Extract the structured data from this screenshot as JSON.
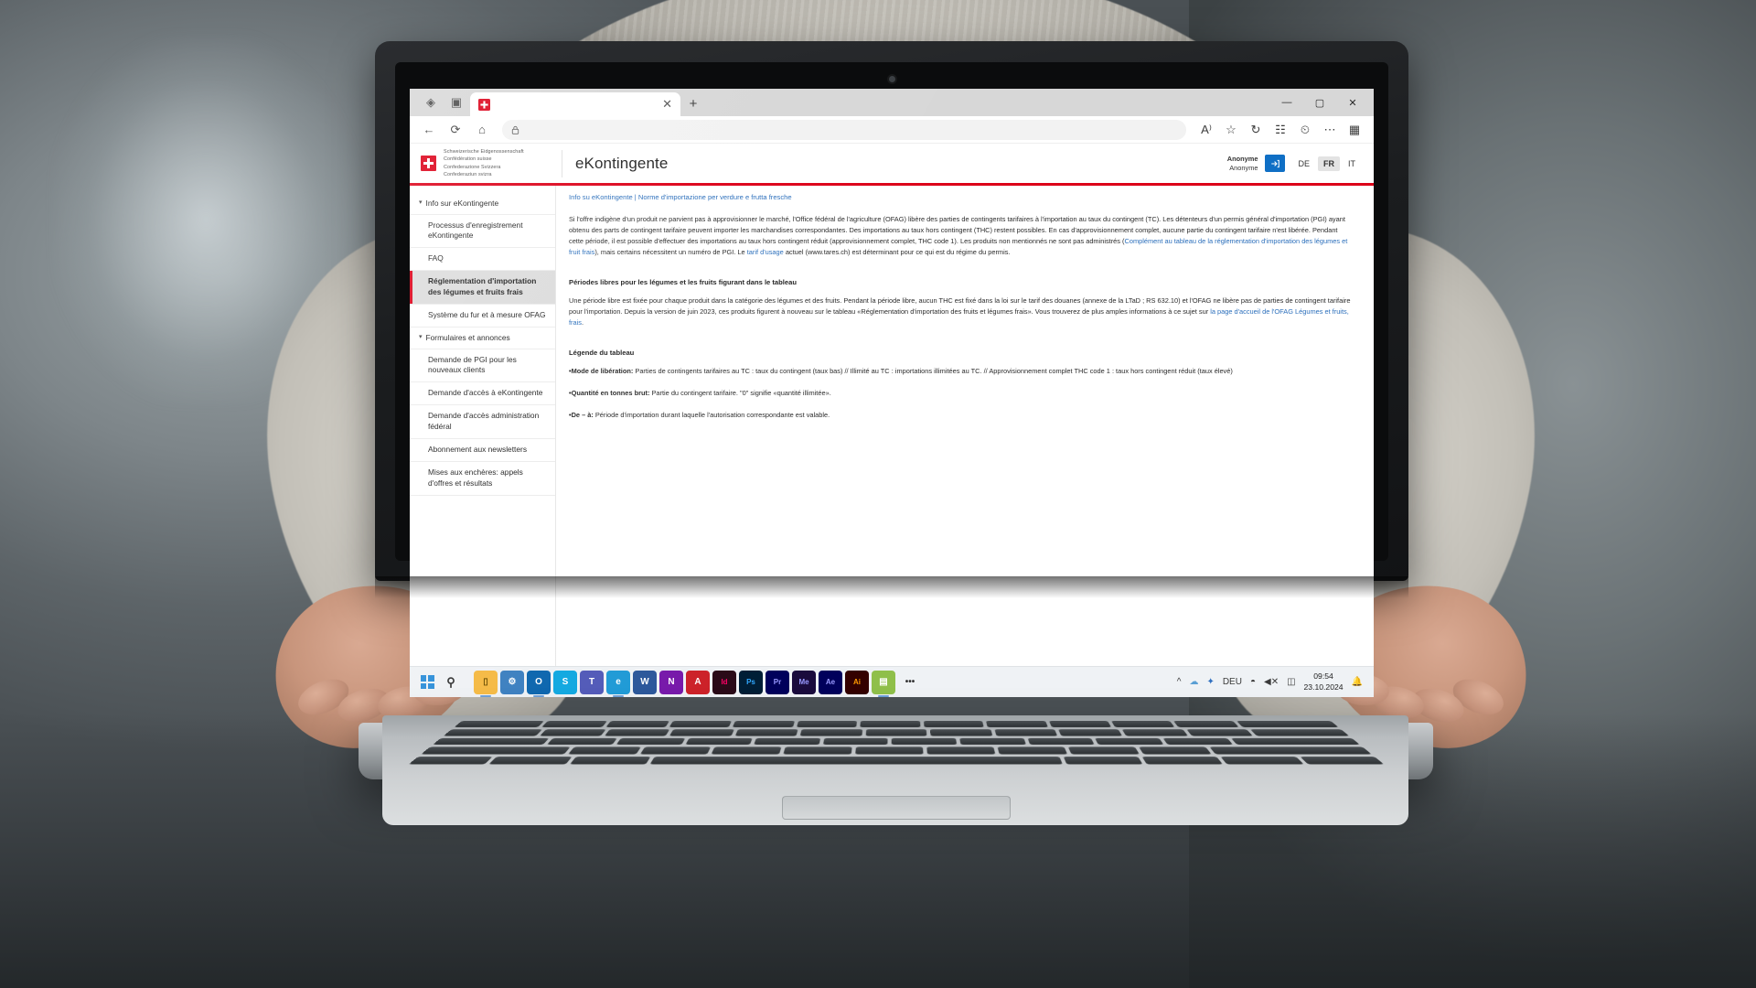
{
  "browser": {
    "tab": {
      "title": "",
      "favicon": "swiss-cross-icon",
      "close_label": "✕"
    },
    "new_tab_label": "+",
    "toolbar_icons": [
      "collections-icon",
      "split-screen-icon"
    ],
    "nav": {
      "back": "←",
      "refresh": "⟳",
      "home": "⌂",
      "address_value": "",
      "lock": "lock-icon"
    },
    "nav_right_icons": [
      "read-aloud-icon",
      "favorite-icon",
      "history-icon",
      "collections-icon",
      "copilot-icon",
      "more-icon",
      "profile-icon"
    ],
    "window_controls": {
      "minimize": "—",
      "maximize": "▢",
      "close": "✕"
    }
  },
  "header": {
    "logo_name": "swiss-confederation-logo",
    "confederation_lines": [
      "Schweizerische Eidgenossenschaft",
      "Confédération suisse",
      "Confederazione Svizzera",
      "Confederaziun svizra"
    ],
    "app_title": "eKontingente",
    "user": {
      "name": "Anonyme",
      "role": "Anonyme"
    },
    "login_icon": "login-arrow-icon",
    "languages": [
      {
        "code": "DE",
        "active": false
      },
      {
        "code": "FR",
        "active": true
      },
      {
        "code": "IT",
        "active": false
      }
    ]
  },
  "sidebar": {
    "groups": [
      {
        "label": "Info sur eKontingente",
        "items": [
          {
            "label": "Processus d'enregistrement eKontingente",
            "active": false
          },
          {
            "label": "FAQ",
            "active": false
          },
          {
            "label": "Réglementation d'importation des légumes et fruits frais",
            "active": true
          },
          {
            "label": "Système du fur et à mesure OFAG",
            "active": false
          }
        ]
      },
      {
        "label": "Formulaires et annonces",
        "items": [
          {
            "label": "Demande de PGI pour les nouveaux clients",
            "active": false
          },
          {
            "label": "Demande d'accès à eKontingente",
            "active": false
          },
          {
            "label": "Demande d'accès administration fédéral",
            "active": false
          },
          {
            "label": "Abonnement aux newsletters",
            "active": false
          },
          {
            "label": "Mises aux enchères: appels d'offres et résultats",
            "active": false
          }
        ]
      }
    ]
  },
  "main": {
    "breadcrumb": "Info su eKontingente | Norme d'importazione per verdure e frutta fresche",
    "paragraph_1": {
      "part_1": "Si l'offre indigène d'un produit ne parvient pas à approvisionner le marché, l'Office fédéral de l'agriculture (OFAG) libère des parties de contingents tarifaires à l'importation au taux du contingent (TC). Les détenteurs d'un permis général d'importation (PGI) ayant obtenu des parts de contingent tarifaire peuvent importer les marchandises correspondantes. Des importations au taux hors contingent (THC) restent possibles. En cas d'approvisionnement complet, aucune partie du contingent tarifaire n'est libérée. Pendant cette période, il est possible d'effectuer des importations au taux hors contingent réduit (approvisionnement complet, THC code 1). Les produits non mentionnés ne sont pas administrés (",
      "link_1": "Complément au tableau de la réglementation d'importation des légumes et fruit frais",
      "part_2": "), mais certains nécessitent un numéro de PGI. Le ",
      "link_2": "tarif d'usage",
      "part_3": " actuel (www.tares.ch) est déterminant pour ce qui est du régime du permis."
    },
    "section_2_title": "Périodes libres pour les légumes et les fruits figurant dans le tableau",
    "paragraph_2": {
      "part_1": "Une période libre est fixée pour chaque produit dans la catégorie des légumes et des fruits. Pendant la période libre, aucun THC est fixé dans la loi sur le tarif des douanes (annexe de la LTaD ; RS 632.10) et l'OFAG ne libère pas de parties de contingent tarifaire pour l'importation. Depuis la version de juin 2023, ces produits figurent à nouveau sur le tableau «Réglementation d'importation des fruits et légumes frais». Vous trouverez de plus amples informations à ce sujet sur ",
      "link_1": "la page d'accueil de l'OFAG Légumes et fruits, frais",
      "part_2": "."
    },
    "section_3_title": "Légende du tableau",
    "legend": [
      {
        "term": "•Mode de libération:",
        "text": " Parties de contingents tarifaires au TC : taux du contingent (taux bas) // Illimité au TC : importations illimitées au TC. // Approvisionnement complet THC code 1 : taux hors contingent réduit (taux élevé)"
      },
      {
        "term": "•Quantité en tonnes brut:",
        "text": " Partie du contingent tarifaire. \"0\" signifie «quantité illimitée»."
      },
      {
        "term": "•De – à:",
        "text": " Période d'importation durant laquelle l'autorisation correspondante est valable."
      }
    ]
  },
  "taskbar": {
    "start_label": "start-icon",
    "search_label": "search-icon",
    "apps": [
      {
        "name": "file-explorer",
        "glyph": "▬",
        "color": "#f5b942",
        "running": true
      },
      {
        "name": "settings",
        "glyph": "⚙",
        "color": "#3a7ebf",
        "running": false
      },
      {
        "name": "outlook",
        "glyph": "O",
        "color": "#0a64ad",
        "running": true
      },
      {
        "name": "skype",
        "glyph": "S",
        "color": "#0fa7e0",
        "running": false
      },
      {
        "name": "teams",
        "glyph": "T",
        "color": "#5159b8",
        "running": false
      },
      {
        "name": "edge",
        "glyph": "e",
        "color": "#1e9ad6",
        "running": true
      },
      {
        "name": "word",
        "glyph": "W",
        "color": "#2b579a",
        "running": false
      },
      {
        "name": "onenote",
        "glyph": "N",
        "color": "#7719aa",
        "running": false
      },
      {
        "name": "acrobat",
        "glyph": "A",
        "color": "#cc2229",
        "running": false
      },
      {
        "name": "indesign",
        "glyph": "Id",
        "color": "#e0457b",
        "running": false
      },
      {
        "name": "photoshop",
        "glyph": "Ps",
        "color": "#31a8ff",
        "running": false
      },
      {
        "name": "premiere",
        "glyph": "Pr",
        "color": "#9999ff",
        "running": false
      },
      {
        "name": "media-encoder",
        "glyph": "Me",
        "color": "#6a5acd",
        "running": false
      },
      {
        "name": "after-effects",
        "glyph": "Ae",
        "color": "#9999ff",
        "running": false
      },
      {
        "name": "illustrator",
        "glyph": "Ai",
        "color": "#ff9a00",
        "running": false
      },
      {
        "name": "calculator",
        "glyph": "▤",
        "color": "#8fbf4a",
        "running": true
      }
    ],
    "overflow_label": "•••",
    "tray": {
      "chevron": "^",
      "cloud": "☁",
      "bluetooth": "✦",
      "keyboard_lang": "DEU",
      "network": "◥",
      "volume": "◁",
      "battery": "▭"
    },
    "clock": {
      "time": "09:54",
      "date": "23.10.2024"
    },
    "notification": "🔔"
  }
}
